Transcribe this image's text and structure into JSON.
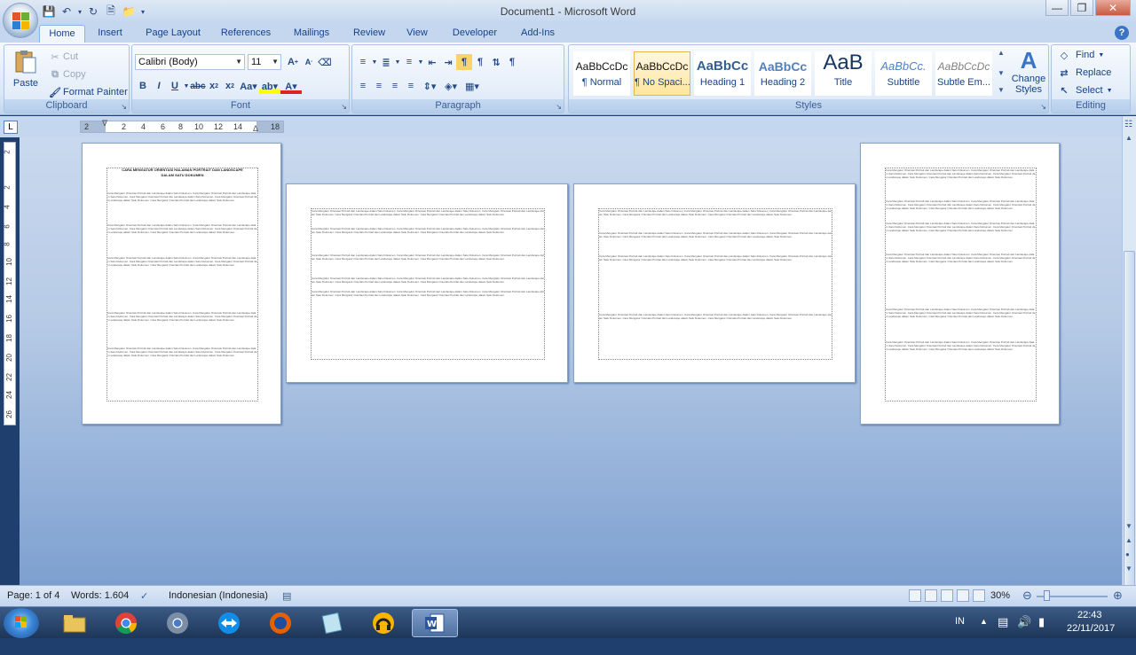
{
  "window": {
    "title": "Document1 - Microsoft Word"
  },
  "tabs": [
    "Home",
    "Insert",
    "Page Layout",
    "References",
    "Mailings",
    "Review",
    "View",
    "Developer",
    "Add-Ins"
  ],
  "clipboard": {
    "paste": "Paste",
    "cut": "Cut",
    "copy": "Copy",
    "format_painter": "Format Painter",
    "label": "Clipboard"
  },
  "font": {
    "family": "Calibri (Body)",
    "size": "11",
    "label": "Font"
  },
  "paragraph": {
    "label": "Paragraph"
  },
  "styles": {
    "label": "Styles",
    "items": [
      {
        "preview": "AaBbCcDc",
        "name": "¶ Normal"
      },
      {
        "preview": "AaBbCcDc",
        "name": "¶ No Spaci..."
      },
      {
        "preview": "AaBbCc",
        "name": "Heading 1"
      },
      {
        "preview": "AaBbCc",
        "name": "Heading 2"
      },
      {
        "preview": "AaB",
        "name": "Title"
      },
      {
        "preview": "AaBbCc.",
        "name": "Subtitle"
      },
      {
        "preview": "AaBbCcDc",
        "name": "Subtle Em..."
      }
    ],
    "change_styles": "Change Styles"
  },
  "editing": {
    "find": "Find",
    "replace": "Replace",
    "select": "Select",
    "label": "Editing"
  },
  "ruler": {
    "numbers": [
      "2",
      "2",
      "4",
      "6",
      "8",
      "10",
      "12",
      "14",
      "18"
    ],
    "vnumbers": [
      "2",
      "2",
      "4",
      "6",
      "8",
      "10",
      "12",
      "14",
      "16",
      "18",
      "20",
      "22",
      "24",
      "26"
    ]
  },
  "document": {
    "title_line1": "CARA MENGATUR ORIENTASI HALAMAN PORTRAIT DAN LANDSCAPE",
    "title_line2": "DALAM SATU DOKUMEN",
    "body_text": "Cara Mengatur Orientasi Portrait dan Landscape dalam Satu Dokumen. Cara Mengatur Orientasi Portrait dan Landscape dalam Satu Dokumen. Cara Mengatur Orientasi Portrait dan Landscape dalam Satu Dokumen. Cara Mengatur Orientasi Portrait dan Landscape dalam Satu Dokumen. Cara Mengatur Orientasi Portrait dan Landscape dalam Satu Dokumen."
  },
  "status": {
    "page": "Page: 1 of 4",
    "words": "Words: 1.604",
    "language": "Indonesian (Indonesia)",
    "zoom": "30%"
  },
  "tray": {
    "lang": "IN",
    "time": "22:43",
    "date": "22/11/2017"
  }
}
